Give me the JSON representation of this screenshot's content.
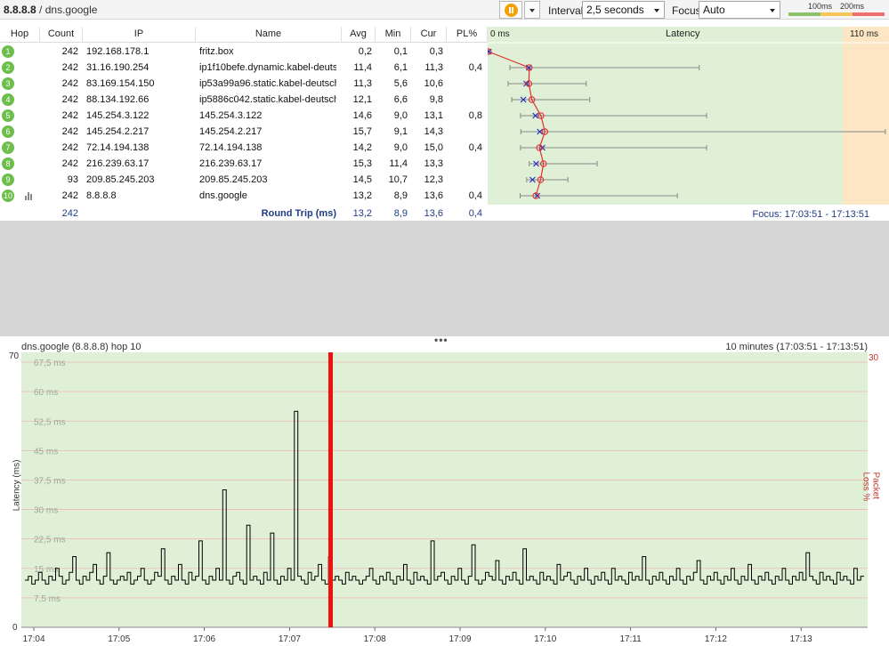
{
  "window": {
    "target_ip": "8.8.8.8",
    "separator": " / ",
    "target_name": "dns.google"
  },
  "toolbar": {
    "interval_label": "Interval",
    "interval_value": "2,5 seconds",
    "focus_label": "Focus",
    "focus_value": "Auto",
    "scale_100": "100ms",
    "scale_200": "200ms",
    "colors": {
      "good": "#8cc36a",
      "warn": "#f6c65a",
      "bad": "#ee6f6f"
    }
  },
  "table": {
    "headers": [
      "Hop",
      "Count",
      "IP",
      "Name",
      "Avg",
      "Min",
      "Cur",
      "PL%"
    ],
    "rows": [
      {
        "hop": "1",
        "count": "242",
        "ip": "192.168.178.1",
        "name": "fritz.box",
        "avg": "0,2",
        "min": "0,1",
        "cur": "0,3",
        "pl": ""
      },
      {
        "hop": "2",
        "count": "242",
        "ip": "31.16.190.254",
        "name": "ip1f10befe.dynamic.kabel-deuts",
        "avg": "11,4",
        "min": "6,1",
        "cur": "11,3",
        "pl": "0,4"
      },
      {
        "hop": "3",
        "count": "242",
        "ip": "83.169.154.150",
        "name": "ip53a99a96.static.kabel-deutsch",
        "avg": "11,3",
        "min": "5,6",
        "cur": "10,6",
        "pl": ""
      },
      {
        "hop": "4",
        "count": "242",
        "ip": "88.134.192.66",
        "name": "ip5886c042.static.kabel-deutsch",
        "avg": "12,1",
        "min": "6,6",
        "cur": "9,8",
        "pl": ""
      },
      {
        "hop": "5",
        "count": "242",
        "ip": "145.254.3.122",
        "name": "145.254.3.122",
        "avg": "14,6",
        "min": "9,0",
        "cur": "13,1",
        "pl": "0,8"
      },
      {
        "hop": "6",
        "count": "242",
        "ip": "145.254.2.217",
        "name": "145.254.2.217",
        "avg": "15,7",
        "min": "9,1",
        "cur": "14,3",
        "pl": ""
      },
      {
        "hop": "7",
        "count": "242",
        "ip": "72.14.194.138",
        "name": "72.14.194.138",
        "avg": "14,2",
        "min": "9,0",
        "cur": "15,0",
        "pl": "0,4"
      },
      {
        "hop": "8",
        "count": "242",
        "ip": "216.239.63.17",
        "name": "216.239.63.17",
        "avg": "15,3",
        "min": "11,4",
        "cur": "13,3",
        "pl": ""
      },
      {
        "hop": "9",
        "count": "93",
        "ip": "209.85.245.203",
        "name": "209.85.245.203",
        "avg": "14,5",
        "min": "10,7",
        "cur": "12,3",
        "pl": ""
      },
      {
        "hop": "10",
        "count": "242",
        "ip": "8.8.8.8",
        "name": "dns.google",
        "avg": "13,2",
        "min": "8,9",
        "cur": "13,6",
        "pl": "0,4"
      }
    ],
    "summary": {
      "count": "242",
      "label": "Round Trip (ms)",
      "avg": "13,2",
      "min": "8,9",
      "cur": "13,6",
      "pl": "0,4"
    }
  },
  "latency_panel": {
    "min_label": "0 ms",
    "title": "Latency",
    "max_label": "110 ms",
    "focus_text": "Focus: 17:03:51 - 17:13:51",
    "max_ms": 110,
    "hops": [
      {
        "avg": 0.2,
        "min": 0.1,
        "cur": 0.3,
        "max": 0.5
      },
      {
        "avg": 11.4,
        "min": 6.1,
        "cur": 11.3,
        "max": 58
      },
      {
        "avg": 11.3,
        "min": 5.6,
        "cur": 10.6,
        "max": 27
      },
      {
        "avg": 12.1,
        "min": 6.6,
        "cur": 9.8,
        "max": 28
      },
      {
        "avg": 14.6,
        "min": 9.0,
        "cur": 13.1,
        "max": 60
      },
      {
        "avg": 15.7,
        "min": 9.1,
        "cur": 14.3,
        "max": 109
      },
      {
        "avg": 14.2,
        "min": 9.0,
        "cur": 15.0,
        "max": 60
      },
      {
        "avg": 15.3,
        "min": 11.4,
        "cur": 13.3,
        "max": 30
      },
      {
        "avg": 14.5,
        "min": 10.7,
        "cur": 12.3,
        "max": 22
      },
      {
        "avg": 13.2,
        "min": 8.9,
        "cur": 13.6,
        "max": 52
      }
    ]
  },
  "graph": {
    "title": "dns.google (8.8.8.8) hop 10",
    "range": "10 minutes (17:03:51 - 17:13:51)",
    "ylabel": "Latency (ms)",
    "y2label": "Packet Loss %",
    "y_max": "70",
    "y_zero": "0",
    "y2_max": "30",
    "y_ticks": [
      "67,5 ms",
      "60 ms",
      "52,5 ms",
      "45 ms",
      "37,5 ms",
      "30 ms",
      "22,5 ms",
      "15 ms",
      "7,5 ms"
    ],
    "x_ticks": [
      "17:04",
      "17:05",
      "17:06",
      "17:07",
      "17:08",
      "17:09",
      "17:10",
      "17:11",
      "17:12",
      "17:13"
    ],
    "bg_color": "#e0f0d6",
    "line_color": "#000000",
    "loss_color": "#ee1111"
  },
  "chart_data": {
    "type": "line",
    "title": "dns.google (8.8.8.8) hop 10",
    "xlabel": "",
    "ylabel": "Latency (ms)",
    "y2label": "Packet Loss %",
    "ylim": [
      0,
      70
    ],
    "y2lim": [
      0,
      30
    ],
    "x_range": [
      "17:03:51",
      "17:13:51"
    ],
    "sample_interval_s": 2.5,
    "loss_events": [
      "17:07:33"
    ],
    "series": [
      {
        "values": [
          12,
          13,
          11,
          12,
          14,
          12,
          11,
          13,
          12,
          15,
          13,
          11,
          12,
          14,
          18,
          12,
          11,
          13,
          12,
          14,
          16,
          12,
          11,
          13,
          19,
          12,
          11,
          12,
          13,
          12,
          14,
          11,
          12,
          13,
          15,
          12,
          11,
          12,
          14,
          13,
          20,
          12,
          11,
          13,
          12,
          16,
          12,
          11,
          14,
          12,
          13,
          22,
          12,
          11,
          13,
          12,
          15,
          12,
          35,
          12,
          11,
          13,
          14,
          12,
          11,
          26,
          12,
          13,
          12,
          11,
          14,
          12,
          24,
          12,
          11,
          13,
          12,
          15,
          12,
          55,
          13,
          12,
          11,
          14,
          12,
          13,
          16,
          12,
          11,
          18,
          12,
          13,
          12,
          11,
          14,
          12,
          13,
          12,
          11,
          12,
          13,
          15,
          12,
          11,
          13,
          12,
          14,
          12,
          11,
          13,
          12,
          16,
          12,
          11,
          14,
          12,
          13,
          12,
          11,
          22,
          12,
          13,
          14,
          12,
          11,
          13,
          12,
          15,
          12,
          11,
          13,
          21,
          12,
          11,
          12,
          14,
          13,
          12,
          17,
          12,
          11,
          13,
          12,
          14,
          12,
          11,
          20,
          12,
          13,
          12,
          11,
          14,
          12,
          13,
          12,
          11,
          16,
          12,
          13,
          14,
          12,
          11,
          13,
          12,
          15,
          12,
          11,
          13,
          12,
          14,
          12,
          11,
          15,
          12,
          13,
          12,
          11,
          14,
          12,
          13,
          12,
          18,
          12,
          11,
          13,
          12,
          14,
          12,
          11,
          13,
          12,
          15,
          12,
          11,
          13,
          12,
          14,
          17,
          12,
          11,
          13,
          12,
          14,
          12,
          11,
          13,
          12,
          15,
          12,
          11,
          13,
          12,
          16,
          12,
          11,
          13,
          12,
          14,
          12,
          11,
          13,
          12,
          15,
          12,
          11,
          13,
          12,
          14,
          12,
          19,
          13,
          12,
          11,
          14,
          12,
          13,
          12,
          11,
          14,
          12,
          13,
          12,
          11,
          15,
          12,
          13
        ]
      }
    ]
  }
}
